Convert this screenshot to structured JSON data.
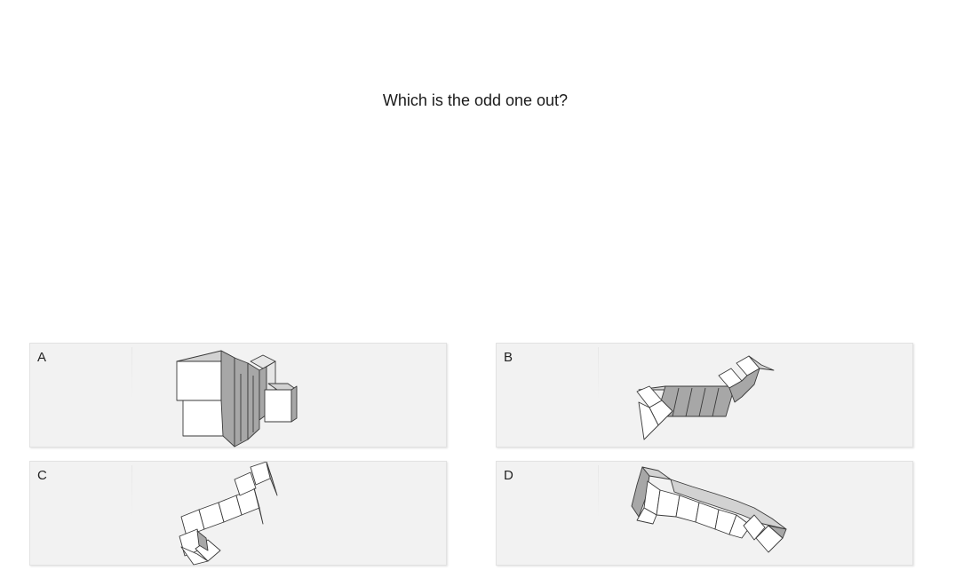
{
  "question": "Which is the odd one out?",
  "options": [
    {
      "label": "A",
      "figure": "cube-structure-a"
    },
    {
      "label": "B",
      "figure": "cube-structure-b"
    },
    {
      "label": "C",
      "figure": "cube-structure-c"
    },
    {
      "label": "D",
      "figure": "cube-structure-d"
    }
  ]
}
